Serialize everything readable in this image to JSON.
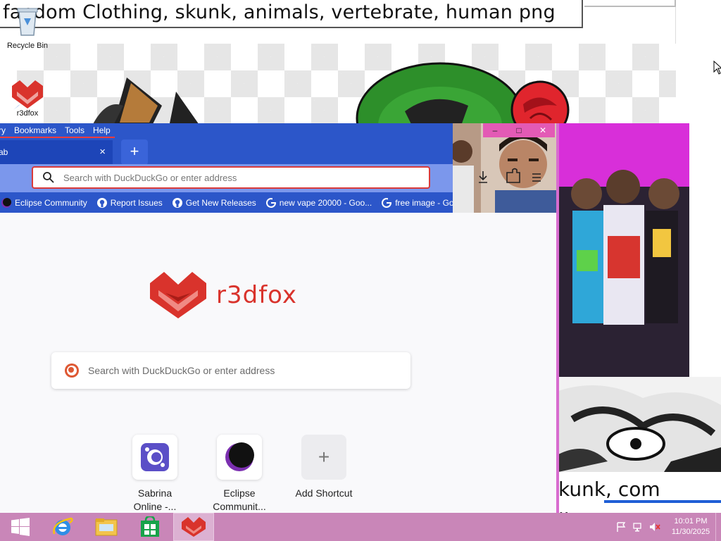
{
  "background": {
    "title_text": "fandom Clothing, skunk, animals, vertebrate, human png",
    "caption_line1": "kunk, com",
    "caption_line2": "line,"
  },
  "desktop": {
    "icons": [
      {
        "label": "Recycle Bin",
        "icon": "recycle-bin-icon"
      },
      {
        "label": "r3dfox",
        "icon": "r3dfox-icon"
      }
    ]
  },
  "browser": {
    "menu": [
      "ry",
      "Bookmarks",
      "Tools",
      "Help"
    ],
    "tab": {
      "label": "ab",
      "close": "×"
    },
    "new_tab": "+",
    "url_placeholder": "Search with DuckDuckGo or enter address",
    "window_controls": {
      "minimize": "–",
      "maximize": "□",
      "close": "✕"
    },
    "bookmarks": [
      {
        "label": "Eclipse Community",
        "icon": "eclipse-icon"
      },
      {
        "label": "Report Issues",
        "icon": "github-icon"
      },
      {
        "label": "Get New Releases",
        "icon": "github-icon"
      },
      {
        "label": "new vape 20000 - Goo...",
        "icon": "google-icon"
      },
      {
        "label": "free image - Google S...",
        "icon": "google-icon"
      }
    ],
    "home": {
      "brand": "r3dfox",
      "search_placeholder": "Search with DuckDuckGo or enter address",
      "shortcuts": [
        {
          "label_line1": "Sabrina",
          "label_line2": "Online -..."
        },
        {
          "label_line1": "Eclipse",
          "label_line2": "Communit..."
        },
        {
          "label_line1": "Add Shortcut",
          "label_line2": ""
        }
      ]
    }
  },
  "taskbar": {
    "apps": [
      "start-button",
      "internet-explorer-icon",
      "file-explorer-icon",
      "store-icon",
      "r3dfox-icon"
    ],
    "clock": {
      "time": "10:01 PM",
      "date": "11/30/2025"
    }
  },
  "colors": {
    "toolbar_blue": "#2c56c9",
    "nav_blue": "#7b97ec",
    "brand_red": "#d9332c",
    "taskbar_pink": "#c986b8"
  }
}
